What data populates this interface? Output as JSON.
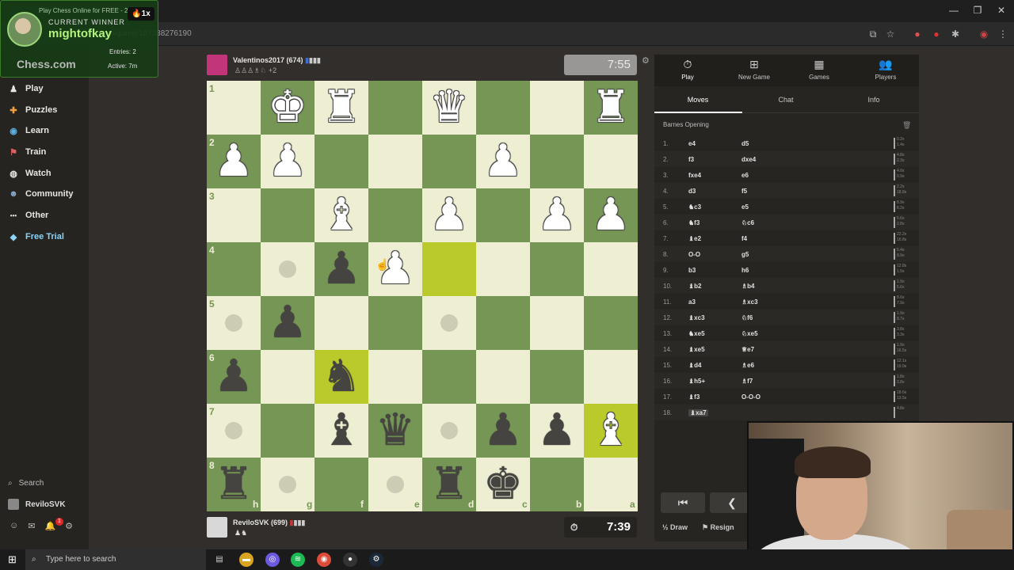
{
  "browser": {
    "tab_title": "Play Chess Online for FREE - 2",
    "url": "chess.com/game/167388276190",
    "url_visible": "m/game/167388276190",
    "win_min": "—",
    "win_restore": "❐",
    "win_close": "✕"
  },
  "overlay": {
    "label": "CURRENT WINNER",
    "winner": "mightofkay",
    "streak": "1x",
    "logo": "Chess.com",
    "entries": "Entries: 2",
    "active": "Active: 7m"
  },
  "sidebar": {
    "items": [
      {
        "label": "Play",
        "icon": "♟"
      },
      {
        "label": "Puzzles",
        "icon": "✚"
      },
      {
        "label": "Learn",
        "icon": "◉"
      },
      {
        "label": "Train",
        "icon": "⚑"
      },
      {
        "label": "Watch",
        "icon": "◍"
      },
      {
        "label": "Community",
        "icon": "☻"
      },
      {
        "label": "Other",
        "icon": "•••"
      },
      {
        "label": "Free Trial",
        "icon": "◆"
      }
    ],
    "search": "Search",
    "username": "ReviloSVK"
  },
  "top_player": {
    "name": "Valentinos2017 (674)",
    "captured": "♙♙♙♗♘ +2",
    "clock": "7:55",
    "flag": "🇫🇷"
  },
  "bottom_player": {
    "name": "ReviloSVK (699)",
    "captured": "♟♞",
    "clock": "7:39"
  },
  "board": {
    "ranks": [
      "1",
      "2",
      "3",
      "4",
      "5",
      "6",
      "7",
      "8"
    ],
    "files": [
      "h",
      "g",
      "f",
      "e",
      "d",
      "c",
      "b",
      "a"
    ],
    "pieces": [
      {
        "sq": "g1",
        "glyph": "♚",
        "color": "white"
      },
      {
        "sq": "f1",
        "glyph": "♜",
        "color": "white"
      },
      {
        "sq": "d1",
        "glyph": "♛",
        "color": "white"
      },
      {
        "sq": "a1",
        "glyph": "♜",
        "color": "white"
      },
      {
        "sq": "h2",
        "glyph": "♟",
        "color": "white"
      },
      {
        "sq": "g2",
        "glyph": "♟",
        "color": "white"
      },
      {
        "sq": "c2",
        "glyph": "♟",
        "color": "white"
      },
      {
        "sq": "f3",
        "glyph": "♝",
        "color": "white"
      },
      {
        "sq": "d3",
        "glyph": "♟",
        "color": "white"
      },
      {
        "sq": "b3",
        "glyph": "♟",
        "color": "white"
      },
      {
        "sq": "a3",
        "glyph": "♟",
        "color": "white"
      },
      {
        "sq": "e4",
        "glyph": "♟",
        "color": "white"
      },
      {
        "sq": "a7",
        "glyph": "♝",
        "color": "white"
      },
      {
        "sq": "f4",
        "glyph": "♟",
        "color": "black"
      },
      {
        "sq": "g5",
        "glyph": "♟",
        "color": "black"
      },
      {
        "sq": "h6",
        "glyph": "♟",
        "color": "black"
      },
      {
        "sq": "f6",
        "glyph": "♞",
        "color": "black"
      },
      {
        "sq": "f7",
        "glyph": "♝",
        "color": "black"
      },
      {
        "sq": "e7",
        "glyph": "♛",
        "color": "black"
      },
      {
        "sq": "c7",
        "glyph": "♟",
        "color": "black"
      },
      {
        "sq": "b7",
        "glyph": "♟",
        "color": "black"
      },
      {
        "sq": "h8",
        "glyph": "♜",
        "color": "black"
      },
      {
        "sq": "d8",
        "glyph": "♜",
        "color": "black"
      },
      {
        "sq": "c8",
        "glyph": "♚",
        "color": "black"
      }
    ],
    "highlights": [
      "d4",
      "f6",
      "a7"
    ],
    "dots": [
      "g4",
      "h5",
      "d5",
      "h7",
      "d7",
      "g8",
      "e8"
    ]
  },
  "panel": {
    "tabs": [
      {
        "label": "Play",
        "icon": "⏱"
      },
      {
        "label": "New Game",
        "icon": "⊞"
      },
      {
        "label": "Games",
        "icon": "▦"
      },
      {
        "label": "Players",
        "icon": "👥"
      }
    ],
    "subtabs": [
      "Moves",
      "Chat",
      "Info"
    ],
    "opening": "Barnes Opening",
    "moves": [
      {
        "n": "1.",
        "w": "e4",
        "b": "d5",
        "tw": "0.2s",
        "tb": "1.4s"
      },
      {
        "n": "2.",
        "w": "f3",
        "b": "dxe4",
        "tw": "4.8s",
        "tb": "2.3s"
      },
      {
        "n": "3.",
        "w": "fxe4",
        "b": "e6",
        "tw": "4.0s",
        "tb": "0.9s"
      },
      {
        "n": "4.",
        "w": "d3",
        "b": "f5",
        "tw": "2.2s",
        "tb": "18.8s"
      },
      {
        "n": "5.",
        "w": "♞c3",
        "b": "e5",
        "tw": "8.9s",
        "tb": "8.2s"
      },
      {
        "n": "6.",
        "w": "♞f3",
        "b": "♘c6",
        "tw": "5.6s",
        "tb": "2.8s"
      },
      {
        "n": "7.",
        "w": "♝e2",
        "b": "f4",
        "tw": "22.2s",
        "tb": "16.8s"
      },
      {
        "n": "8.",
        "w": "O-O",
        "b": "g5",
        "tw": "5.4s",
        "tb": "8.9s"
      },
      {
        "n": "9.",
        "w": "b3",
        "b": "h6",
        "tw": "12.8s",
        "tb": "1.5s"
      },
      {
        "n": "10.",
        "w": "♝b2",
        "b": "♗b4",
        "tw": "1.9s",
        "tb": "5.6s"
      },
      {
        "n": "11.",
        "w": "a3",
        "b": "♗xc3",
        "tw": "8.6s",
        "tb": "7.9s"
      },
      {
        "n": "12.",
        "w": "♝xc3",
        "b": "♘f6",
        "tw": "1.9s",
        "tb": "8.7s"
      },
      {
        "n": "13.",
        "w": "♞xe5",
        "b": "♘xe5",
        "tw": "3.8s",
        "tb": "3.3s"
      },
      {
        "n": "14.",
        "w": "♝xe5",
        "b": "♕e7",
        "tw": "1.9s",
        "tb": "16.5s"
      },
      {
        "n": "15.",
        "w": "♝d4",
        "b": "♗e6",
        "tw": "12.1s",
        "tb": "19.9s"
      },
      {
        "n": "16.",
        "w": "♝h5+",
        "b": "♗f7",
        "tw": "1.8s",
        "tb": "3.8s"
      },
      {
        "n": "17.",
        "w": "♝f3",
        "b": "O-O-O",
        "tw": "18.6s",
        "tb": "13.5s"
      },
      {
        "n": "18.",
        "w": "♝xa7",
        "b": "",
        "tw": "4.8s",
        "tb": ""
      }
    ],
    "nav_first": "⏮",
    "nav_prev": "❮",
    "draw": "½ Draw",
    "resign": "⚑ Resign"
  },
  "taskbar": {
    "search_placeholder": "Type here to search"
  }
}
